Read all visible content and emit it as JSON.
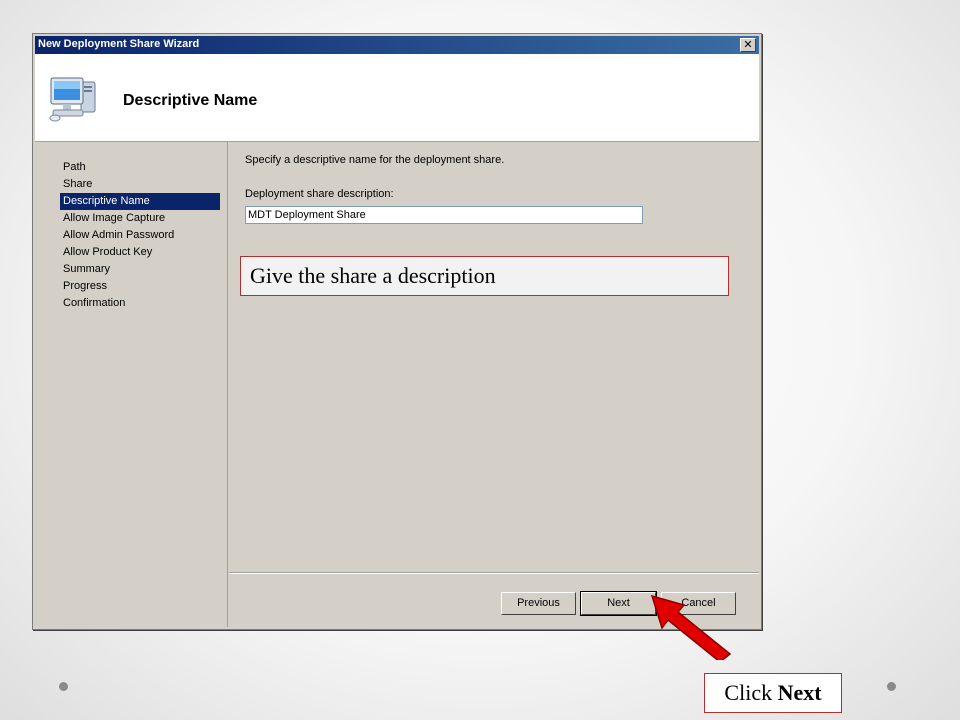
{
  "window": {
    "title": "New Deployment Share Wizard",
    "close_glyph": "✕"
  },
  "header": {
    "title": "Descriptive Name",
    "icon": "computer-monitor-icon"
  },
  "nav": {
    "items": [
      {
        "label": "Path",
        "active": false
      },
      {
        "label": "Share",
        "active": false
      },
      {
        "label": "Descriptive Name",
        "active": true
      },
      {
        "label": "Allow Image Capture",
        "active": false
      },
      {
        "label": "Allow Admin Password",
        "active": false
      },
      {
        "label": "Allow Product Key",
        "active": false
      },
      {
        "label": "Summary",
        "active": false
      },
      {
        "label": "Progress",
        "active": false
      },
      {
        "label": "Confirmation",
        "active": false
      }
    ]
  },
  "content": {
    "instruction": "Specify a descriptive name for the deployment share.",
    "field_label": "Deployment share description:",
    "field_value": "MDT Deployment Share"
  },
  "buttons": {
    "previous": "Previous",
    "next": "Next",
    "cancel": "Cancel"
  },
  "annotations": {
    "callout": "Give the share a description",
    "click_prefix": "Click ",
    "click_target": "Next",
    "arrow_color": "#e00000"
  }
}
